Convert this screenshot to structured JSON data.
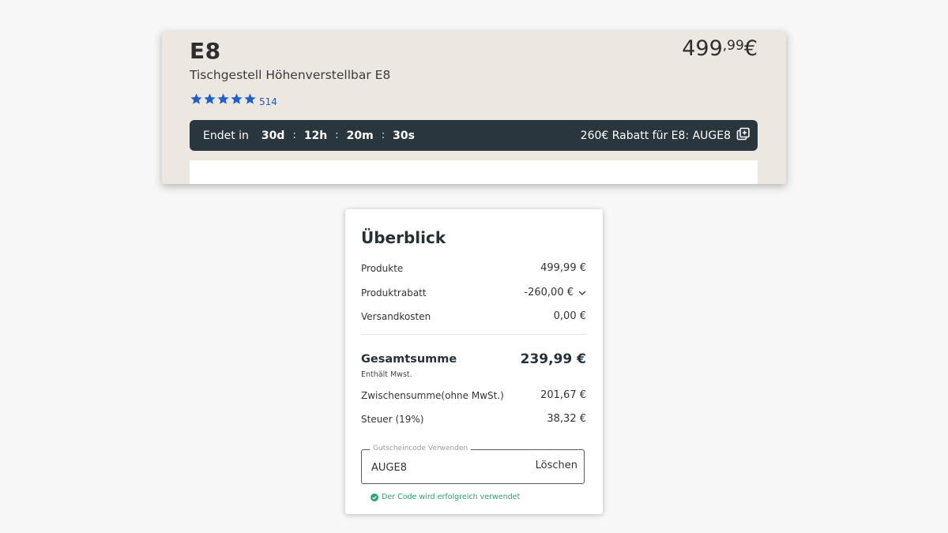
{
  "product": {
    "model": "E8",
    "price_main": "499",
    "price_cents": ",99",
    "price_currency": "€",
    "subtitle": "Tischgestell Höhenverstellbar E8",
    "rating_stars": 5,
    "rating_count": "514",
    "star_color": "#1e5fd0"
  },
  "promo": {
    "ends_label": "Endet in",
    "timer": {
      "days": "30d",
      "hours": "12h",
      "minutes": "20m",
      "seconds": "30s",
      "separator": ":"
    },
    "discount_text": "260€ Rabatt für E8: AUGE8",
    "bar_color": "#2a363d",
    "copy_icon": "copy-icon"
  },
  "overview": {
    "title": "Überblick",
    "rows": [
      {
        "label": "Produkte",
        "value": "499,99 €"
      },
      {
        "label": "Produktrabatt",
        "value": "-260,00 €"
      },
      {
        "label": "Versandkosten",
        "value": "0,00 €"
      }
    ],
    "total_label": "Gesamtsumme",
    "total_value": "239,99 €",
    "vat_note": "Enthält Mwst.",
    "subtotal_label": "Zwischensumme(ohne MwSt.)",
    "subtotal_value": "201,67 €",
    "tax_label": "Steuer (19%)",
    "tax_value": "38,32 €",
    "voucher": {
      "legend": "Gutscheincode Verwenden",
      "value": "AUGE8",
      "delete_label": "Löschen"
    },
    "success_message": "Der Code wird erfolgreich verwendet",
    "success_color": "#2fa36b"
  }
}
